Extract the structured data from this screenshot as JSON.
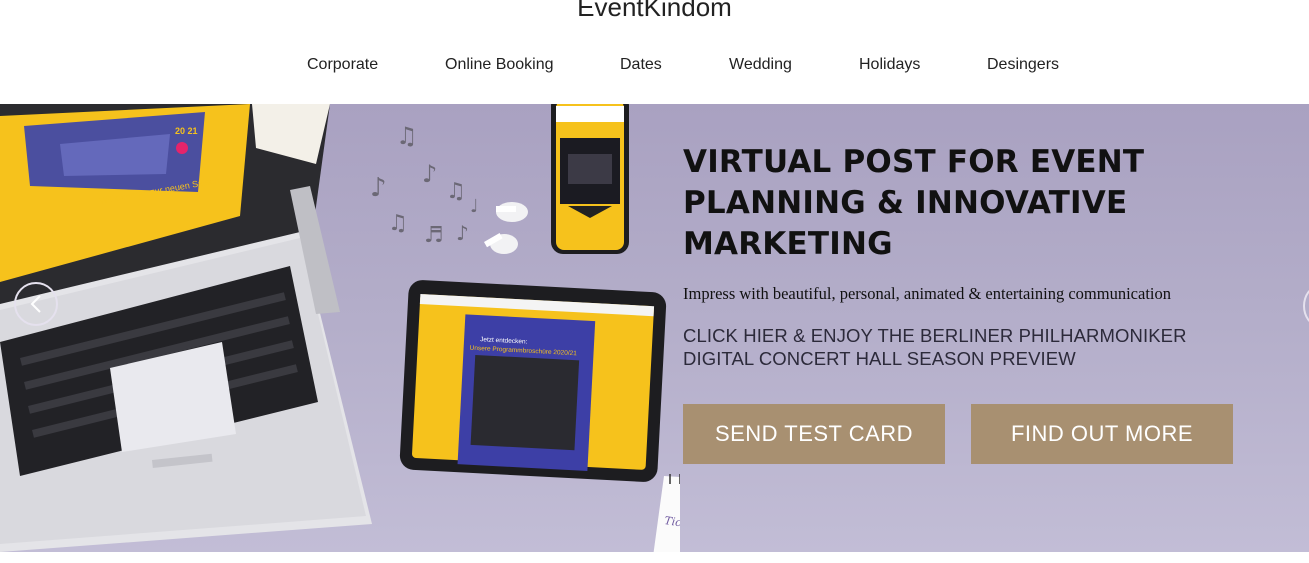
{
  "site": {
    "brand": "EventKindom"
  },
  "nav": {
    "items": [
      {
        "label": "Corporate"
      },
      {
        "label": "Online Booking"
      },
      {
        "label": "Dates"
      },
      {
        "label": "Wedding"
      },
      {
        "label": "Holidays"
      },
      {
        "label": "Desingers"
      }
    ]
  },
  "hero": {
    "title": "VIRTUAL POST FOR EVENT PLANNING & INNOVATIVE MARKETING",
    "subtitle": "Impress with beautiful, personal, animated & entertaining communication",
    "cta_text": "CLICK HIER & ENJOY THE BERLINER PHILHARMONIKER DIGITAL CONCERT HALL SEASON PREVIEW",
    "buttons": {
      "send": "SEND TEST CARD",
      "more": "FIND OUT MORE"
    },
    "image": {
      "tablet_line1": "Jetzt entdecken:",
      "tablet_line2": "Unsere Programmbroschüre 2020/21",
      "note_text": "Tickets besorgen!",
      "laptop_text": "Willkommen zur neuen Saison",
      "year_badge": "20 21"
    },
    "colors": {
      "background": "#b3adc9",
      "button": "#a89071",
      "accent_yellow": "#f6c21c"
    }
  }
}
